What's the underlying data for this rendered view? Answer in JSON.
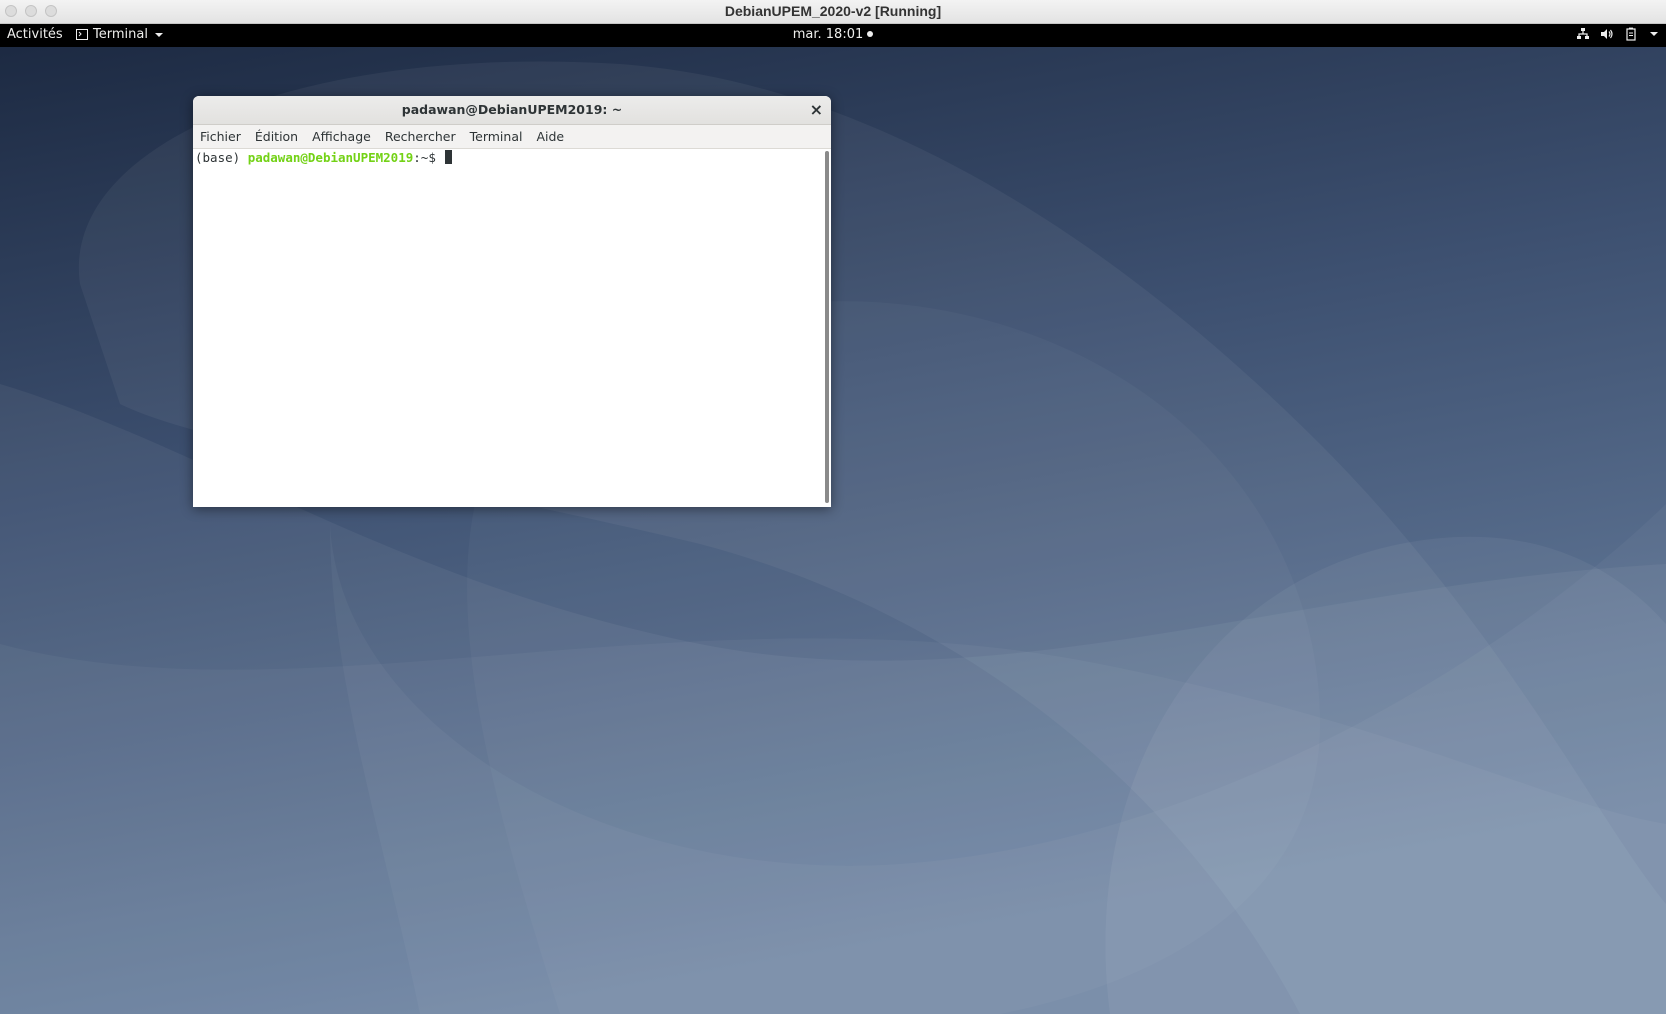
{
  "host": {
    "window_title": "DebianUPEM_2020-v2 [Running]"
  },
  "topbar": {
    "activities": "Activités",
    "app_menu": "Terminal",
    "clock": "mar. 18:01"
  },
  "terminal": {
    "title": "padawan@DebianUPEM2019: ~",
    "close_glyph": "×",
    "menu": [
      "Fichier",
      "Édition",
      "Affichage",
      "Rechercher",
      "Terminal",
      "Aide"
    ],
    "prompt": {
      "env": "(base) ",
      "user_host": "padawan@DebianUPEM2019",
      "path": ":~$ "
    }
  },
  "colors": {
    "topbar_bg": "#000000",
    "prompt_green": "#73d216",
    "wallpaper_dark": "#1f2d46",
    "wallpaper_light": "#6b82a0"
  },
  "icons": {
    "network": "network-icon",
    "volume": "volume-icon",
    "battery": "battery-icon",
    "system_menu": "chevron-down-icon",
    "app": "terminal-icon"
  }
}
